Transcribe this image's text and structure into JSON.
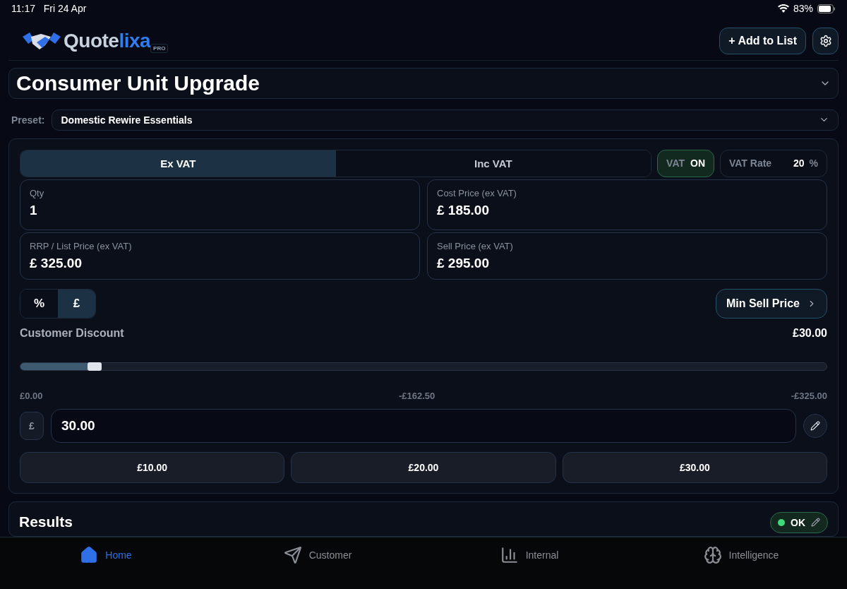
{
  "status_bar": {
    "time": "11:17",
    "date": "Fri 24 Apr",
    "battery": "83%"
  },
  "header": {
    "wordmark": [
      "Quote",
      "lixa"
    ],
    "badge": "PRO",
    "add_button": "+ Add to List"
  },
  "title": {
    "text": "Consumer Unit Upgrade",
    "expanded": false
  },
  "preset": {
    "label": "Preset:",
    "value": "Domestic Rewire Essentials"
  },
  "vat_tabs": [
    {
      "label": "Ex VAT",
      "selected": true
    },
    {
      "label": "Inc VAT",
      "selected": false
    }
  ],
  "vat_toggle": {
    "label": "VAT",
    "state": "ON",
    "on": true
  },
  "vat_rate": {
    "label": "VAT Rate",
    "value": "20",
    "unit": "%"
  },
  "fields": [
    {
      "label": "Qty",
      "value": "1"
    },
    {
      "label": "Cost Price (ex VAT)",
      "value": "£ 185.00"
    },
    {
      "label": "RRP / List Price (ex VAT)",
      "value": "£ 325.00"
    },
    {
      "label": "Sell Price (ex VAT)",
      "value": "£ 295.00"
    }
  ],
  "mode_toggle": [
    {
      "label": "%",
      "selected": false
    },
    {
      "label": "£",
      "selected": true
    }
  ],
  "min_sell_button": "Min Sell Price",
  "discount": {
    "label": "Customer Discount",
    "amount": "£30.00",
    "level": 0.092,
    "ticks": [
      "£0.00",
      "-£162.50",
      "-£325.00"
    ],
    "prefix": "£",
    "value": "30.00"
  },
  "quick_amounts": [
    "£10.00",
    "£20.00",
    "£30.00"
  ],
  "results": {
    "title": "Results",
    "status": "OK"
  },
  "nav": [
    {
      "label": "Home",
      "selected": true
    },
    {
      "label": "Customer",
      "selected": false
    },
    {
      "label": "Internal",
      "selected": false
    },
    {
      "label": "Intelligence",
      "selected": false
    }
  ]
}
